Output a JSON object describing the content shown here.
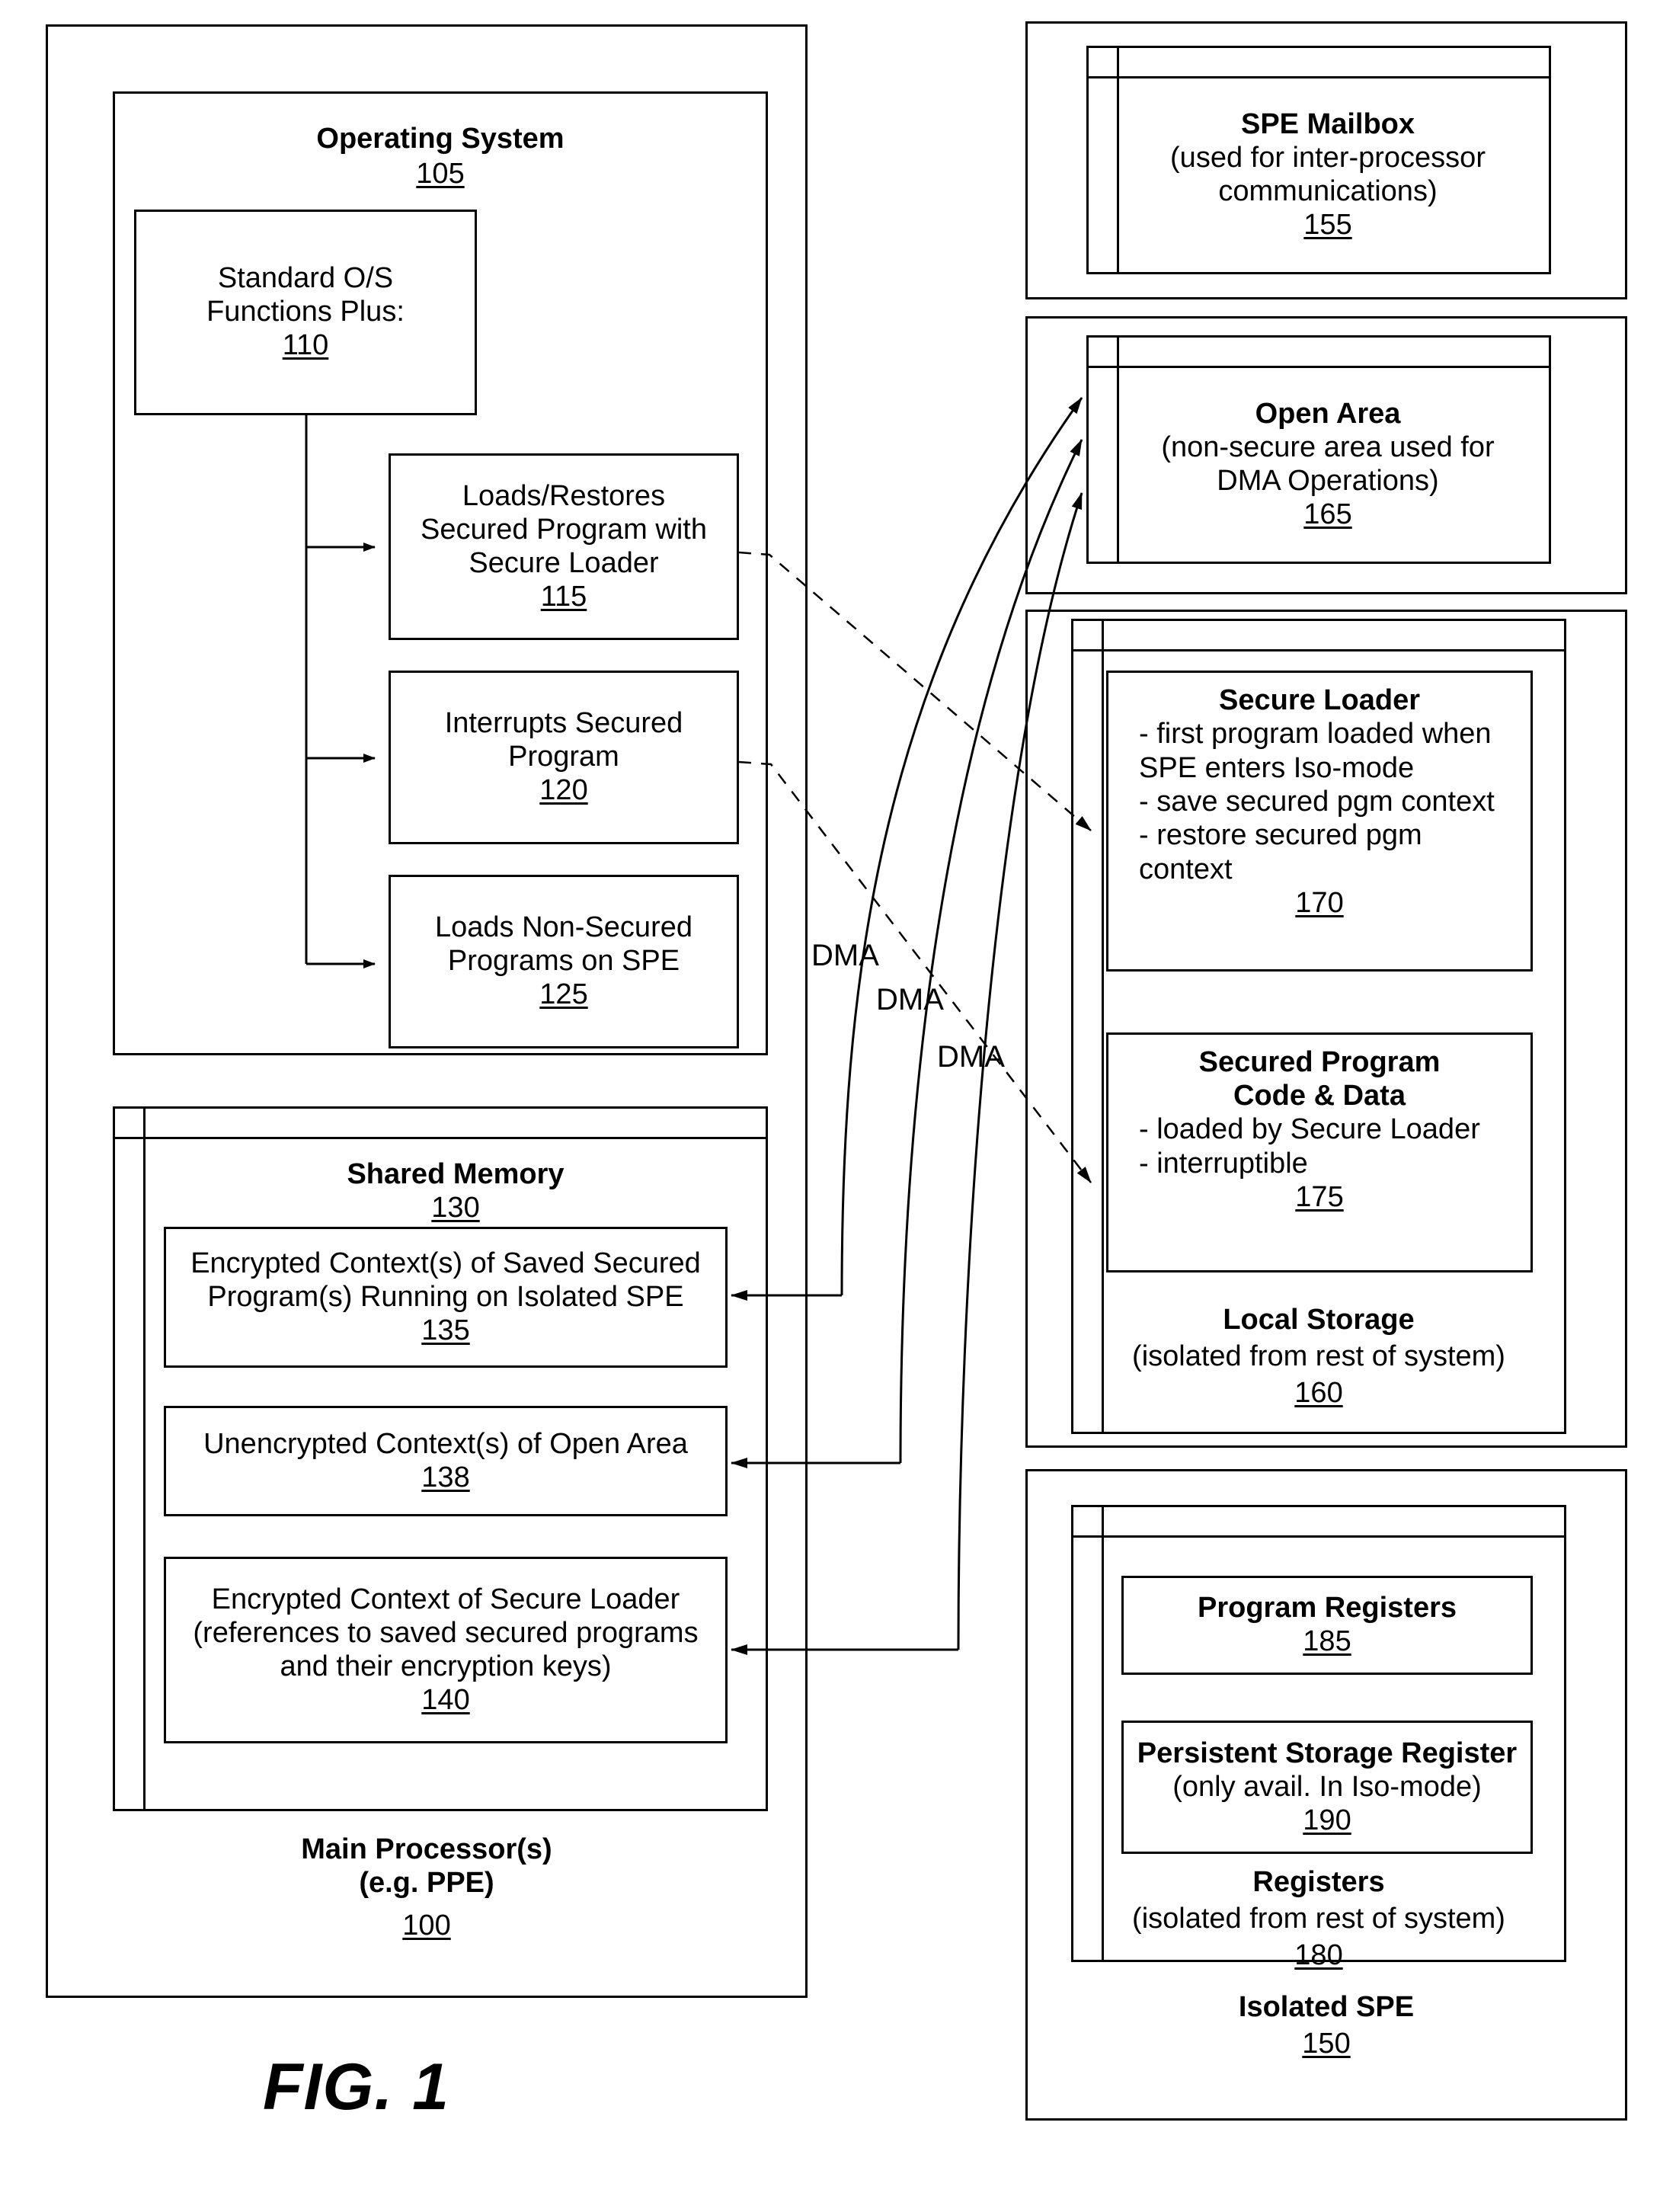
{
  "figure": {
    "label": "FIG. 1"
  },
  "left_panel": {
    "name": "Main Processor(s) panel",
    "footer_title": "Main Processor(s)\n(e.g. PPE)",
    "footer_number": "100",
    "operating_system": {
      "title": "Operating System",
      "number": "105",
      "standard_functions": {
        "title": "Standard O/S\nFunctions Plus:",
        "number": "110"
      },
      "functions": [
        {
          "title": "Loads/Restores\nSecured Program with\nSecure Loader",
          "number": "115"
        },
        {
          "title": "Interrupts Secured\nProgram",
          "number": "120"
        },
        {
          "title": "Loads Non-Secured\nPrograms on SPE",
          "number": "125"
        }
      ]
    },
    "shared_memory": {
      "title": "Shared Memory",
      "number": "130",
      "items": [
        {
          "title": "Encrypted Context(s) of Saved Secured\nProgram(s) Running on Isolated SPE",
          "number": "135"
        },
        {
          "title": "Unencrypted Context(s) of Open Area",
          "number": "138"
        },
        {
          "title": "Encrypted Context of Secure Loader\n(references to saved secured programs\nand their encryption keys)",
          "number": "140"
        }
      ]
    }
  },
  "right_panel": {
    "name": "Isolated SPE panel",
    "footer_title": "Isolated SPE",
    "footer_number": "150",
    "spe_mailbox": {
      "title": "SPE Mailbox",
      "subtitle": "(used for inter-processor\ncommunications)",
      "number": "155"
    },
    "open_area": {
      "title": "Open Area",
      "subtitle": "(non-secure area used for\nDMA Operations)",
      "number": "165"
    },
    "local_storage": {
      "title": "Local Storage",
      "subtitle": "(isolated from rest of system)",
      "number": "160",
      "items": [
        {
          "title": "Secure Loader",
          "bullets": "- first program loaded when\n   SPE enters Iso-mode\n- save secured pgm context\n- restore secured pgm\n   context",
          "number": "170"
        },
        {
          "title": "Secured Program\nCode & Data",
          "bullets": "- loaded by Secure Loader\n- interruptible",
          "number": "175"
        }
      ]
    },
    "registers": {
      "title": "Registers",
      "subtitle": "(isolated from rest of system)",
      "number": "180",
      "items": [
        {
          "title": "Program Registers",
          "subtitle": "",
          "number": "185"
        },
        {
          "title": "Persistent Storage Register",
          "subtitle": "(only avail. In Iso-mode)",
          "number": "190"
        }
      ]
    }
  },
  "connectors": {
    "dma_labels": [
      "DMA",
      "DMA",
      "DMA"
    ]
  },
  "colors": {
    "stroke": "#000000",
    "background": "#ffffff"
  }
}
